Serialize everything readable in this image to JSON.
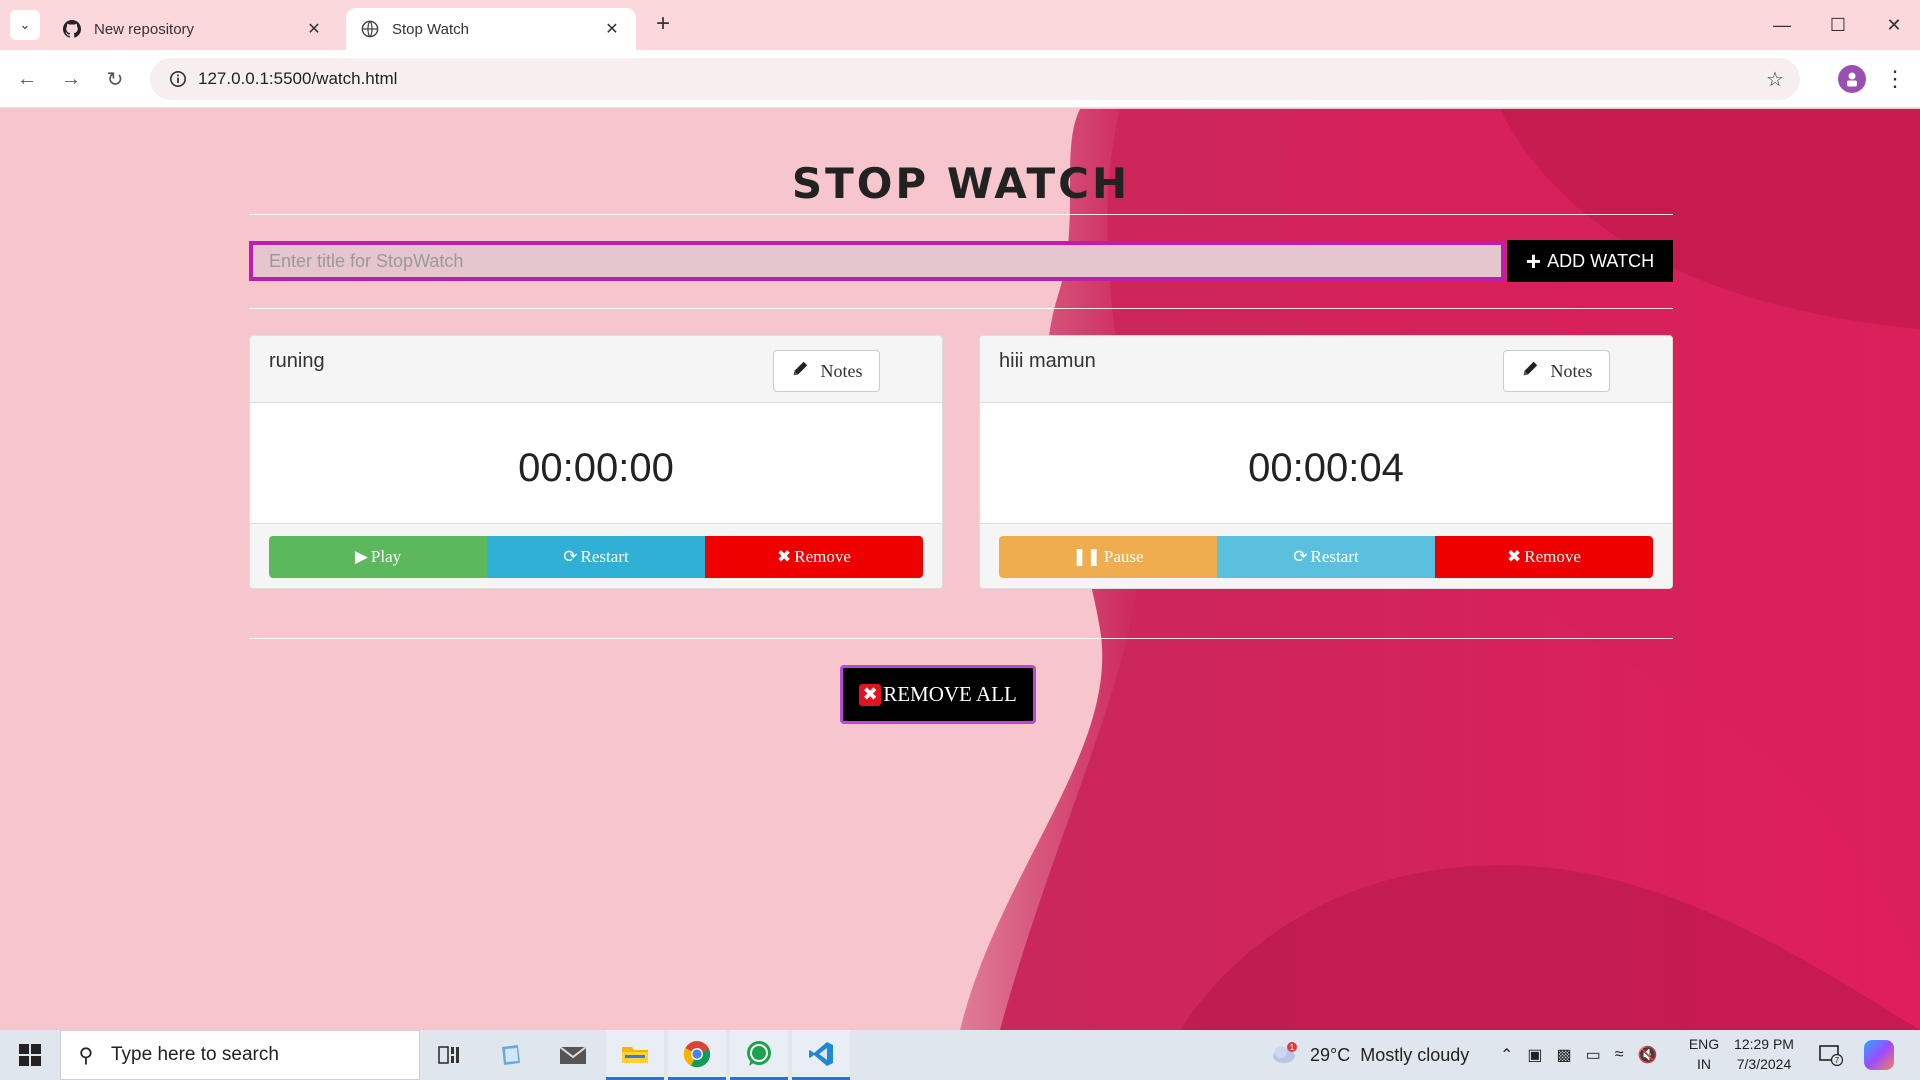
{
  "browser": {
    "tabs": [
      {
        "title": "New repository",
        "icon": "github-icon",
        "active": false
      },
      {
        "title": "Stop Watch",
        "icon": "globe-icon",
        "active": true
      }
    ],
    "url": "127.0.0.1:5500/watch.html"
  },
  "page": {
    "title": "STOP WATCH",
    "input_placeholder": "Enter title for StopWatch",
    "input_value": "",
    "add_button_label": "ADD WATCH",
    "watches": [
      {
        "name": "runing",
        "notes_label": "Notes",
        "time": "00:00:00",
        "buttons": {
          "primary": "Play",
          "restart": "Restart",
          "remove": "Remove"
        },
        "running": false
      },
      {
        "name": "hiii mamun",
        "notes_label": "Notes",
        "time": "00:00:04",
        "buttons": {
          "primary": "Pause",
          "restart": "Restart",
          "remove": "Remove"
        },
        "running": true
      }
    ],
    "remove_all_label": "REMOVE ALL",
    "colors": {
      "input_border": "#c01cb0",
      "play": "#5cb85c",
      "restart": "#31b0d5",
      "remove": "#ee0000",
      "pause": "#f0ad4e",
      "remove_all_border": "#b44ad6"
    }
  },
  "taskbar": {
    "search_placeholder": "Type here to search",
    "weather": {
      "temp": "29°C",
      "condition": "Mostly cloudy",
      "badge": "1"
    },
    "lang": {
      "line1": "ENG",
      "line2": "IN"
    },
    "clock": {
      "time": "12:29 PM",
      "date": "7/3/2024"
    },
    "notification_count": "7",
    "pinned": [
      "task-view-icon",
      "file-explorer-icon",
      "mail-icon",
      "folder-icon",
      "chrome-icon",
      "whatsapp-icon",
      "vscode-icon"
    ]
  }
}
